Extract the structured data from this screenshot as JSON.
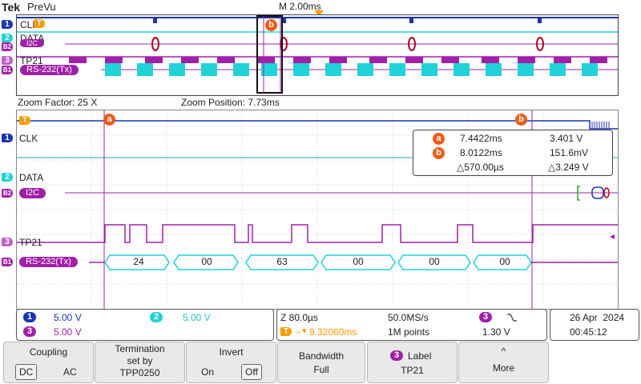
{
  "header": {
    "brand": "Tek",
    "mode": "PreVu",
    "timebase": "M 2.00ms"
  },
  "overview": {
    "labels": {
      "ch1": "CLK",
      "ch2": "DATA",
      "b2": "I2C",
      "ch3": "TP21",
      "b1": "RS-232(Tx)"
    },
    "cursor_b": "b"
  },
  "zoom": {
    "factor": "Zoom Factor: 25 X",
    "position": "Zoom Position: 7.73ms"
  },
  "main_labels": {
    "ch1": "CLK",
    "ch2": "DATA",
    "b2": "I2C",
    "ch3": "TP21",
    "b1": "RS-232(Tx)"
  },
  "channel_markers": {
    "c1": "1",
    "c2": "2",
    "c3": "3",
    "b1": "B1",
    "b2": "B2",
    "t": "T"
  },
  "cursors": {
    "a": {
      "symbol": "a",
      "time": "7.4422ms",
      "volt": "3.401 V"
    },
    "b": {
      "symbol": "b",
      "time": "8.0122ms",
      "volt": "151.6mV"
    },
    "delta_t": "△570.00µs",
    "delta_v": "△3.249 V"
  },
  "decode_bytes": [
    "24",
    "00",
    "63",
    "00",
    "00",
    "00"
  ],
  "status": {
    "ch1_scale": "5.00 V",
    "ch2_scale": "5.00 V",
    "ch3_scale": "5.00 V",
    "zoom_scale": "Z 80.0µs",
    "sample_rate": "50.0MS/s",
    "trigger_pos": "9.32060ms",
    "record_length": "1M points",
    "trigger_ch": "3",
    "trigger_level": "1.30 V",
    "date": "26 Apr  2024",
    "time": "00:45:12"
  },
  "buttons": {
    "coupling": {
      "title": "Coupling",
      "opt_dc": "DC",
      "opt_ac": "AC"
    },
    "termination": {
      "line1": "Termination",
      "line2": "set by",
      "line3": "TPP0250"
    },
    "invert": {
      "title": "Invert",
      "opt_on": "On",
      "opt_off": "Off"
    },
    "bandwidth": {
      "title": "Bandwidth",
      "value": "Full"
    },
    "label": {
      "ch": "3",
      "title": "Label",
      "value": "TP21"
    },
    "more": {
      "title": "More"
    }
  },
  "colors": {
    "ch1": "#1a35b0",
    "ch2": "#1fd3d8",
    "ch3": "#a020a8",
    "cursor": "#ee5b16",
    "trigger": "#ff9a00"
  }
}
